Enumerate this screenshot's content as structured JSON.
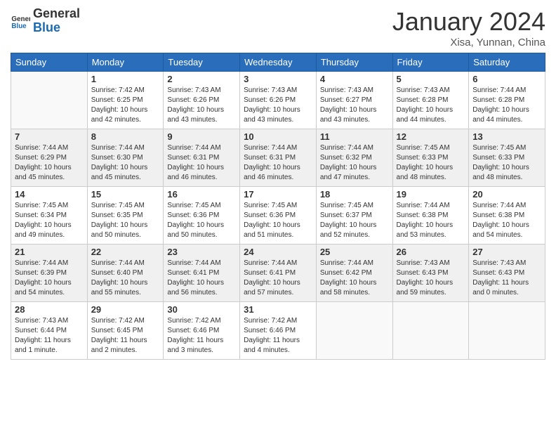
{
  "logo": {
    "general": "General",
    "blue": "Blue"
  },
  "header": {
    "month": "January 2024",
    "location": "Xisa, Yunnan, China"
  },
  "weekdays": [
    "Sunday",
    "Monday",
    "Tuesday",
    "Wednesday",
    "Thursday",
    "Friday",
    "Saturday"
  ],
  "weeks": [
    [
      {
        "day": "",
        "sunrise": "",
        "sunset": "",
        "daylight": ""
      },
      {
        "day": "1",
        "sunrise": "Sunrise: 7:42 AM",
        "sunset": "Sunset: 6:25 PM",
        "daylight": "Daylight: 10 hours and 42 minutes."
      },
      {
        "day": "2",
        "sunrise": "Sunrise: 7:43 AM",
        "sunset": "Sunset: 6:26 PM",
        "daylight": "Daylight: 10 hours and 43 minutes."
      },
      {
        "day": "3",
        "sunrise": "Sunrise: 7:43 AM",
        "sunset": "Sunset: 6:26 PM",
        "daylight": "Daylight: 10 hours and 43 minutes."
      },
      {
        "day": "4",
        "sunrise": "Sunrise: 7:43 AM",
        "sunset": "Sunset: 6:27 PM",
        "daylight": "Daylight: 10 hours and 43 minutes."
      },
      {
        "day": "5",
        "sunrise": "Sunrise: 7:43 AM",
        "sunset": "Sunset: 6:28 PM",
        "daylight": "Daylight: 10 hours and 44 minutes."
      },
      {
        "day": "6",
        "sunrise": "Sunrise: 7:44 AM",
        "sunset": "Sunset: 6:28 PM",
        "daylight": "Daylight: 10 hours and 44 minutes."
      }
    ],
    [
      {
        "day": "7",
        "sunrise": "Sunrise: 7:44 AM",
        "sunset": "Sunset: 6:29 PM",
        "daylight": "Daylight: 10 hours and 45 minutes."
      },
      {
        "day": "8",
        "sunrise": "Sunrise: 7:44 AM",
        "sunset": "Sunset: 6:30 PM",
        "daylight": "Daylight: 10 hours and 45 minutes."
      },
      {
        "day": "9",
        "sunrise": "Sunrise: 7:44 AM",
        "sunset": "Sunset: 6:31 PM",
        "daylight": "Daylight: 10 hours and 46 minutes."
      },
      {
        "day": "10",
        "sunrise": "Sunrise: 7:44 AM",
        "sunset": "Sunset: 6:31 PM",
        "daylight": "Daylight: 10 hours and 46 minutes."
      },
      {
        "day": "11",
        "sunrise": "Sunrise: 7:44 AM",
        "sunset": "Sunset: 6:32 PM",
        "daylight": "Daylight: 10 hours and 47 minutes."
      },
      {
        "day": "12",
        "sunrise": "Sunrise: 7:45 AM",
        "sunset": "Sunset: 6:33 PM",
        "daylight": "Daylight: 10 hours and 48 minutes."
      },
      {
        "day": "13",
        "sunrise": "Sunrise: 7:45 AM",
        "sunset": "Sunset: 6:33 PM",
        "daylight": "Daylight: 10 hours and 48 minutes."
      }
    ],
    [
      {
        "day": "14",
        "sunrise": "Sunrise: 7:45 AM",
        "sunset": "Sunset: 6:34 PM",
        "daylight": "Daylight: 10 hours and 49 minutes."
      },
      {
        "day": "15",
        "sunrise": "Sunrise: 7:45 AM",
        "sunset": "Sunset: 6:35 PM",
        "daylight": "Daylight: 10 hours and 50 minutes."
      },
      {
        "day": "16",
        "sunrise": "Sunrise: 7:45 AM",
        "sunset": "Sunset: 6:36 PM",
        "daylight": "Daylight: 10 hours and 50 minutes."
      },
      {
        "day": "17",
        "sunrise": "Sunrise: 7:45 AM",
        "sunset": "Sunset: 6:36 PM",
        "daylight": "Daylight: 10 hours and 51 minutes."
      },
      {
        "day": "18",
        "sunrise": "Sunrise: 7:45 AM",
        "sunset": "Sunset: 6:37 PM",
        "daylight": "Daylight: 10 hours and 52 minutes."
      },
      {
        "day": "19",
        "sunrise": "Sunrise: 7:44 AM",
        "sunset": "Sunset: 6:38 PM",
        "daylight": "Daylight: 10 hours and 53 minutes."
      },
      {
        "day": "20",
        "sunrise": "Sunrise: 7:44 AM",
        "sunset": "Sunset: 6:38 PM",
        "daylight": "Daylight: 10 hours and 54 minutes."
      }
    ],
    [
      {
        "day": "21",
        "sunrise": "Sunrise: 7:44 AM",
        "sunset": "Sunset: 6:39 PM",
        "daylight": "Daylight: 10 hours and 54 minutes."
      },
      {
        "day": "22",
        "sunrise": "Sunrise: 7:44 AM",
        "sunset": "Sunset: 6:40 PM",
        "daylight": "Daylight: 10 hours and 55 minutes."
      },
      {
        "day": "23",
        "sunrise": "Sunrise: 7:44 AM",
        "sunset": "Sunset: 6:41 PM",
        "daylight": "Daylight: 10 hours and 56 minutes."
      },
      {
        "day": "24",
        "sunrise": "Sunrise: 7:44 AM",
        "sunset": "Sunset: 6:41 PM",
        "daylight": "Daylight: 10 hours and 57 minutes."
      },
      {
        "day": "25",
        "sunrise": "Sunrise: 7:44 AM",
        "sunset": "Sunset: 6:42 PM",
        "daylight": "Daylight: 10 hours and 58 minutes."
      },
      {
        "day": "26",
        "sunrise": "Sunrise: 7:43 AM",
        "sunset": "Sunset: 6:43 PM",
        "daylight": "Daylight: 10 hours and 59 minutes."
      },
      {
        "day": "27",
        "sunrise": "Sunrise: 7:43 AM",
        "sunset": "Sunset: 6:43 PM",
        "daylight": "Daylight: 11 hours and 0 minutes."
      }
    ],
    [
      {
        "day": "28",
        "sunrise": "Sunrise: 7:43 AM",
        "sunset": "Sunset: 6:44 PM",
        "daylight": "Daylight: 11 hours and 1 minute."
      },
      {
        "day": "29",
        "sunrise": "Sunrise: 7:42 AM",
        "sunset": "Sunset: 6:45 PM",
        "daylight": "Daylight: 11 hours and 2 minutes."
      },
      {
        "day": "30",
        "sunrise": "Sunrise: 7:42 AM",
        "sunset": "Sunset: 6:46 PM",
        "daylight": "Daylight: 11 hours and 3 minutes."
      },
      {
        "day": "31",
        "sunrise": "Sunrise: 7:42 AM",
        "sunset": "Sunset: 6:46 PM",
        "daylight": "Daylight: 11 hours and 4 minutes."
      },
      {
        "day": "",
        "sunrise": "",
        "sunset": "",
        "daylight": ""
      },
      {
        "day": "",
        "sunrise": "",
        "sunset": "",
        "daylight": ""
      },
      {
        "day": "",
        "sunrise": "",
        "sunset": "",
        "daylight": ""
      }
    ]
  ]
}
